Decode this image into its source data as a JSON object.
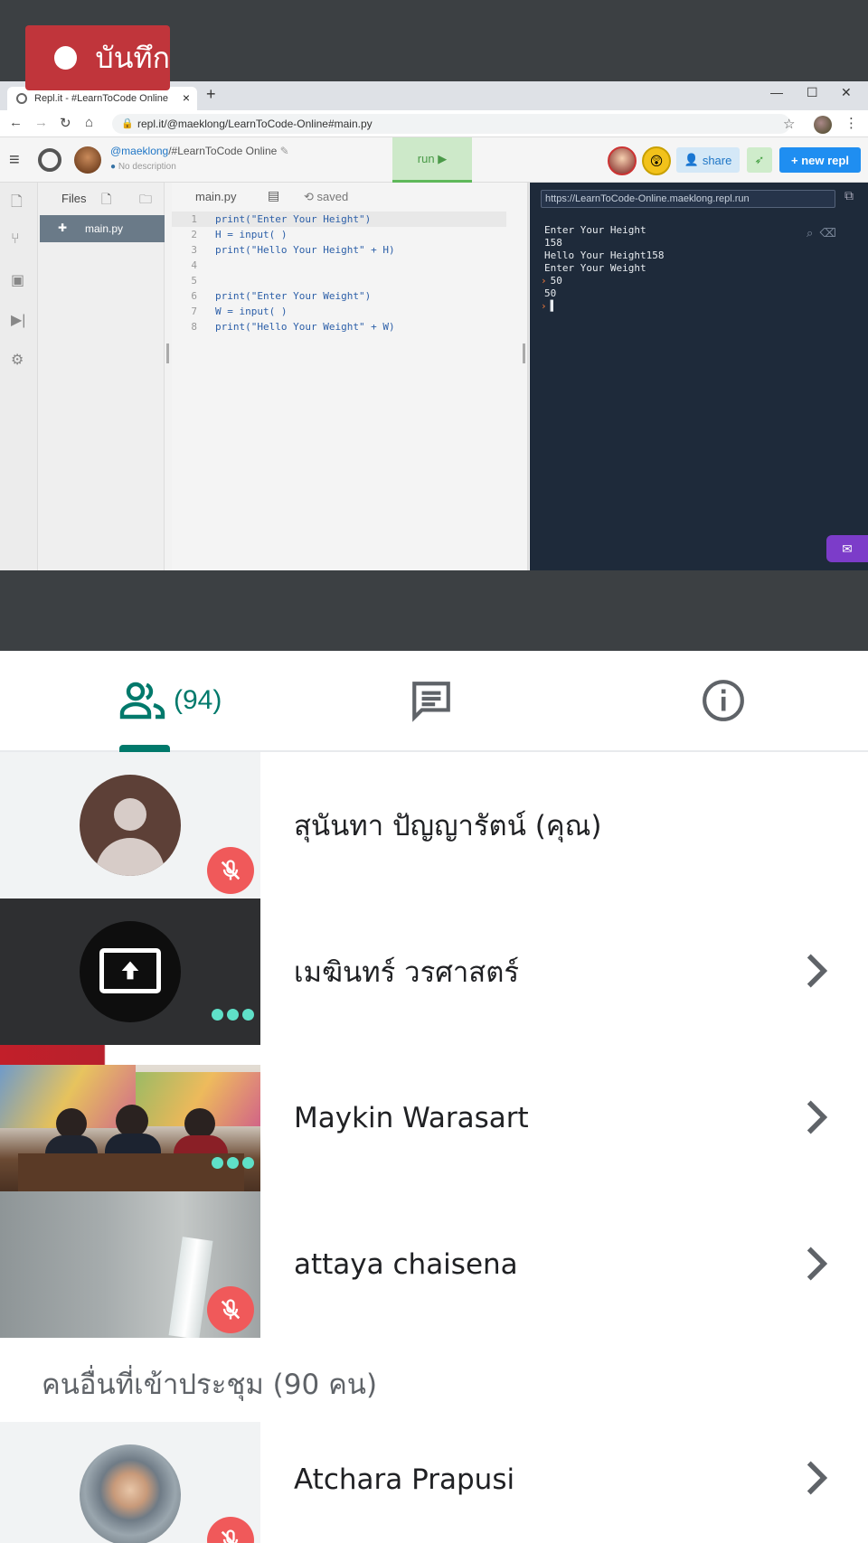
{
  "recording": {
    "label": "บันทึก"
  },
  "presentation": {
    "browser": {
      "tab_title": "Repl.it - #LearnToCode Online",
      "url": "repl.it/@maeklong/LearnToCode-Online#main.py"
    },
    "repl": {
      "owner": "@maeklong",
      "name": "/#LearnToCode Online",
      "description": "No description",
      "run_label": "run ▶",
      "share_label": "share",
      "new_repl_label": "+ new repl",
      "files_label": "Files",
      "selected_file": "main.py",
      "editor_tab": "main.py",
      "saved_label": "saved",
      "code_lines": [
        {
          "n": "1",
          "text": "print(\"Enter Your Height\")"
        },
        {
          "n": "2",
          "text": "H = input( )"
        },
        {
          "n": "3",
          "text": "print(\"Hello Your Height\" + H)"
        },
        {
          "n": "4",
          "text": ""
        },
        {
          "n": "5",
          "text": ""
        },
        {
          "n": "6",
          "text": "print(\"Enter Your Weight\")"
        },
        {
          "n": "7",
          "text": "W = input( )"
        },
        {
          "n": "8",
          "text": "print(\"Hello Your Weight\" + W)"
        }
      ],
      "console_url": "https://LearnToCode-Online.maeklong.repl.run",
      "console_lines": [
        {
          "prompt": "",
          "text": "Enter Your Height"
        },
        {
          "prompt": "",
          "text": "158"
        },
        {
          "prompt": "",
          "text": "Hello Your Height158"
        },
        {
          "prompt": "",
          "text": "Enter Your Weight"
        },
        {
          "prompt": "›",
          "text": "50"
        },
        {
          "prompt": "",
          "text": "50"
        },
        {
          "prompt": "›",
          "text": "▌"
        }
      ]
    }
  },
  "tabs": {
    "people_count": "(94)",
    "accent_color": "#00796b"
  },
  "participants": [
    {
      "name": "สุนันทา ปัญญารัตน์ (คุณ)",
      "muted": true
    },
    {
      "name": "เมฆินทร์ วรศาสตร์",
      "presenting": true
    },
    {
      "name": "Maykin Warasart"
    },
    {
      "name": "attaya chaisena",
      "muted": true
    }
  ],
  "others_section": {
    "label": "คนอื่นที่เข้าประชุม (90 คน)"
  },
  "others": [
    {
      "name": "Atchara Prapusi",
      "muted": true
    }
  ]
}
